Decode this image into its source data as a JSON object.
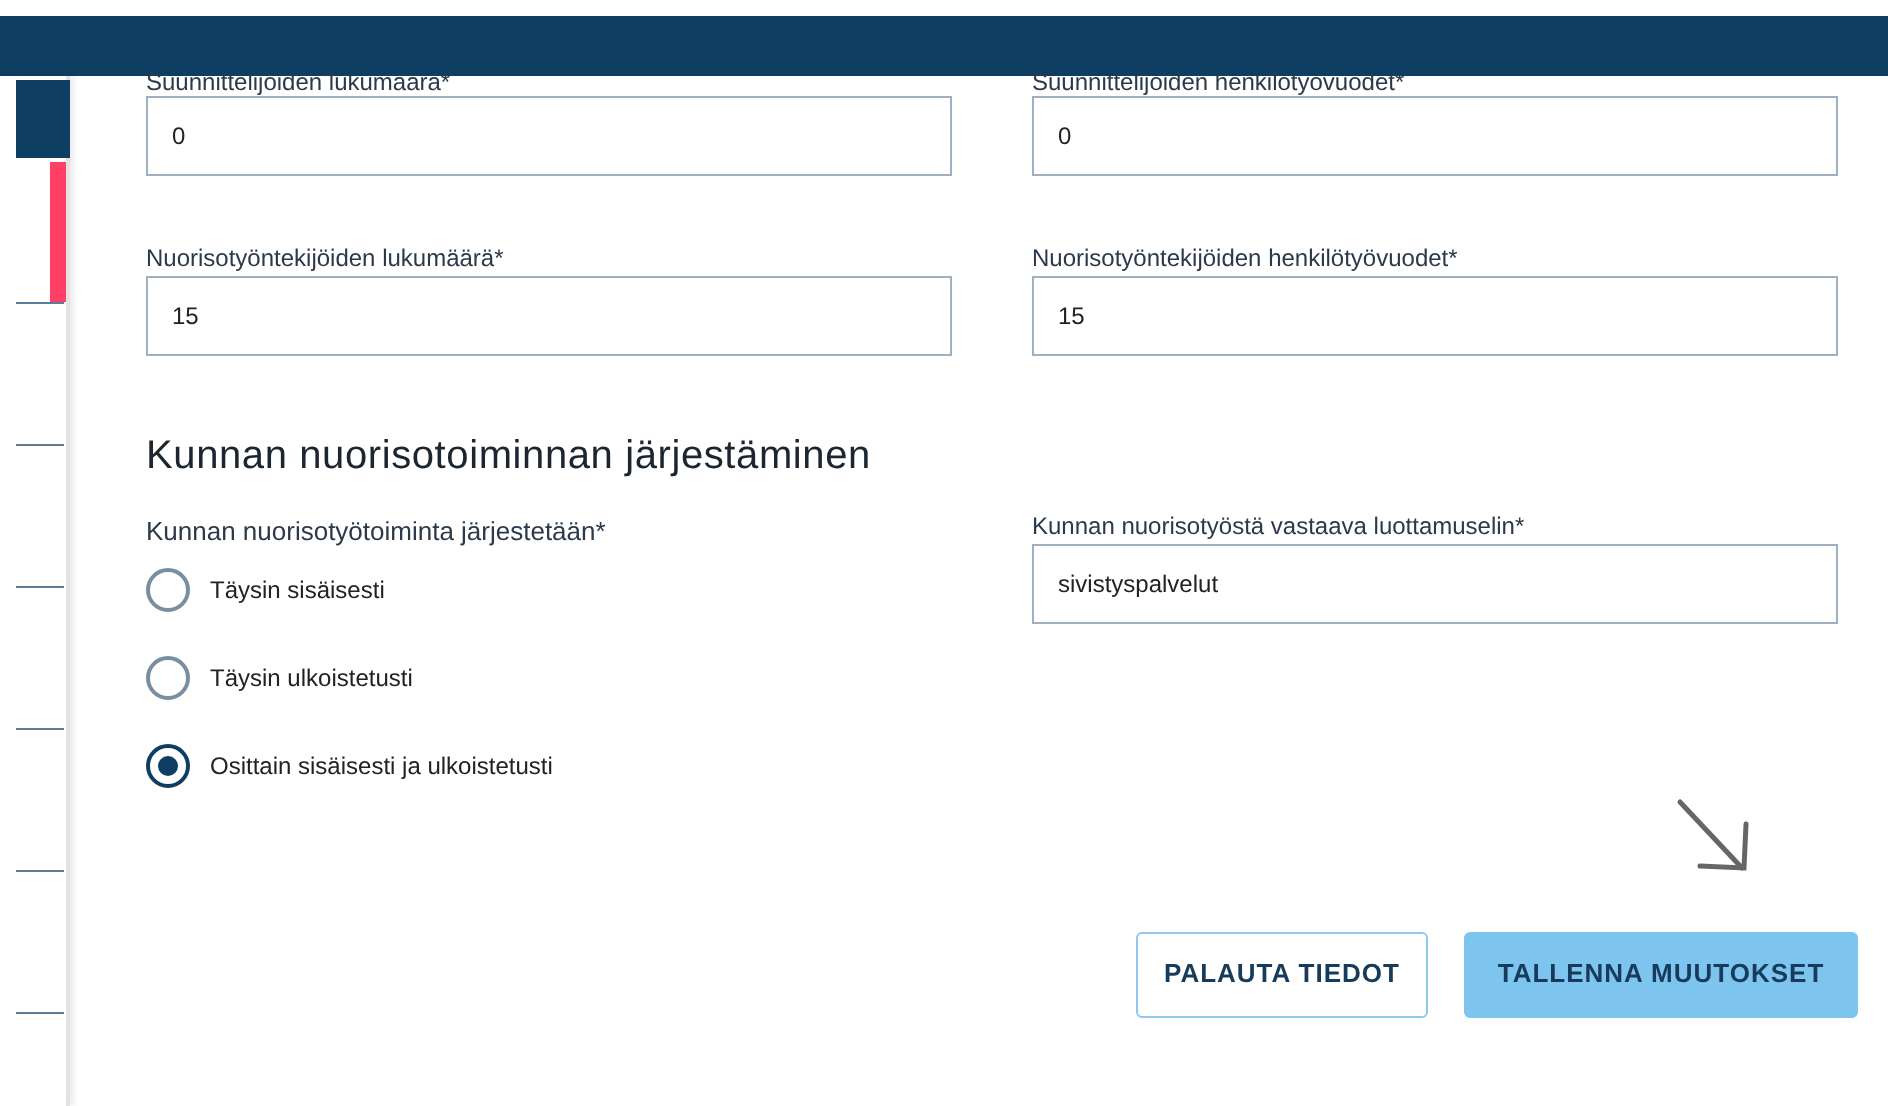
{
  "fields_top": [
    {
      "label": "Suunnittelijoiden lukumäärä*",
      "value": "0"
    },
    {
      "label": "Suunnittelijoiden henkilötyövuodet*",
      "value": "0"
    },
    {
      "label": "Nuorisotyöntekijöiden lukumäärä*",
      "value": "15"
    },
    {
      "label": "Nuorisotyöntekijöiden henkilötyövuodet*",
      "value": "15"
    }
  ],
  "section": {
    "heading": "Kunnan nuorisotoiminnan järjestäminen",
    "radio_group": {
      "label": "Kunnan nuorisotyötoiminta järjestetään*",
      "options": [
        {
          "label": "Täysin sisäisesti",
          "selected": false
        },
        {
          "label": "Täysin ulkoistetusti",
          "selected": false
        },
        {
          "label": "Osittain sisäisesti ja ulkoistetusti",
          "selected": true
        }
      ]
    },
    "field": {
      "label": "Kunnan nuorisotyöstä vastaava luottamuselin*",
      "value": "sivistyspalvelut"
    }
  },
  "buttons": [
    {
      "label": "PALAUTA TIEDOT",
      "kind": "secondary"
    },
    {
      "label": "TALLENNA MUUTOKSET",
      "kind": "primary"
    }
  ]
}
